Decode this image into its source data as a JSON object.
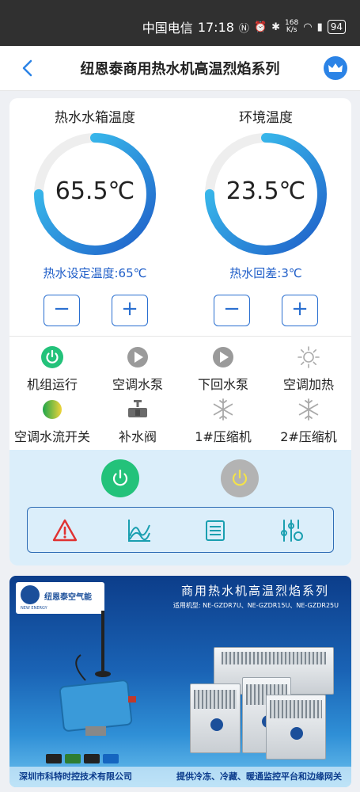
{
  "status_bar": {
    "carrier": "中国电信",
    "time": "17:18",
    "net_speed_top": "168",
    "net_speed_unit": "K/s",
    "battery": "94"
  },
  "nav": {
    "title": "纽恩泰商用热水机高温烈焰系列"
  },
  "gauges": [
    {
      "title": "热水水箱温度",
      "value": "65.5℃",
      "setpoint": "热水设定温度:65℃",
      "fill": 0.75
    },
    {
      "title": "环境温度",
      "value": "23.5℃",
      "setpoint": "热水回差:3℃",
      "fill": 0.75
    }
  ],
  "steppers": {
    "minus": "−",
    "plus": "+"
  },
  "status_items": [
    {
      "label": "机组运行",
      "icon": "power-on-icon"
    },
    {
      "label": "空调水泵",
      "icon": "play-icon"
    },
    {
      "label": "下回水泵",
      "icon": "play-icon"
    },
    {
      "label": "空调加热",
      "icon": "sun-icon"
    },
    {
      "label": "空调水流开关",
      "icon": "flow-switch-icon"
    },
    {
      "label": "补水阀",
      "icon": "valve-icon"
    },
    {
      "label": "1#压缩机",
      "icon": "snowflake-icon"
    },
    {
      "label": "2#压缩机",
      "icon": "snowflake-icon"
    }
  ],
  "colors": {
    "accent": "#2b83e6",
    "gauge_start": "#1f5ec8",
    "gauge_end": "#3fd0f4",
    "power_on": "#23c27a",
    "power_off": "#b3b3b3",
    "warning": "#e03232"
  },
  "banner": {
    "logo_text": "纽恩泰空气能",
    "logo_sub": "NEW ENERGY",
    "title": "商用热水机高温烈焰系列",
    "models": "适用机型: NE-GZDR7U、NE-GZDR15U、NE-GZDR25U",
    "company": "深圳市科特时控技术有限公司",
    "slogan": "提供冷冻、冷藏、暖通监控平台和边缘网关"
  }
}
